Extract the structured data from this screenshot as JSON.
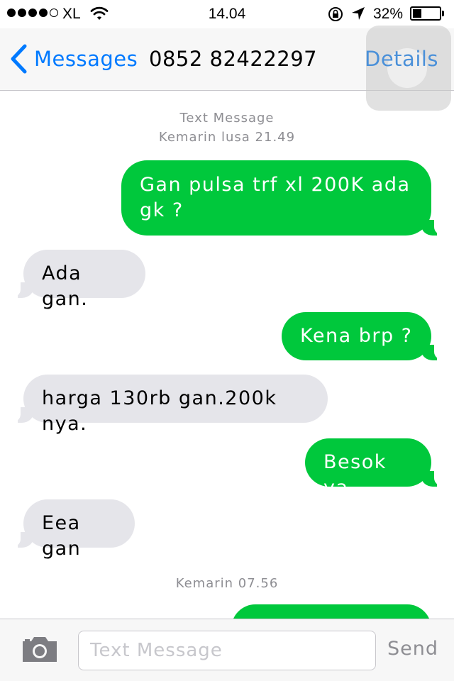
{
  "status_bar": {
    "carrier": "XL",
    "time": "14.04",
    "battery_percent": "32%",
    "battery_level": 0.32,
    "signal_bars": 4,
    "signal_total": 5
  },
  "nav": {
    "back_label": "Messages",
    "title": "0852 82422297",
    "details_label": "Details"
  },
  "colors": {
    "accent": "#007aff",
    "outgoing_bubble": "#00c83c",
    "incoming_bubble": "#e5e5ea"
  },
  "thread": {
    "header_type": "Text Message",
    "header_time": "Kemarin lusa 21.49",
    "second_time": "Kemarin 07.56",
    "messages": [
      {
        "direction": "outgoing",
        "text": "Gan pulsa trf xl 200K ada gk ?"
      },
      {
        "direction": "incoming",
        "text": "Ada gan."
      },
      {
        "direction": "outgoing",
        "text": "Kena brp ?"
      },
      {
        "direction": "incoming",
        "text": "harga 130rb gan.200k nya."
      },
      {
        "direction": "outgoing",
        "text": "Besok ya"
      },
      {
        "direction": "incoming",
        "text": "Eea gan"
      }
    ]
  },
  "compose": {
    "placeholder": "Text Message",
    "send_label": "Send"
  }
}
